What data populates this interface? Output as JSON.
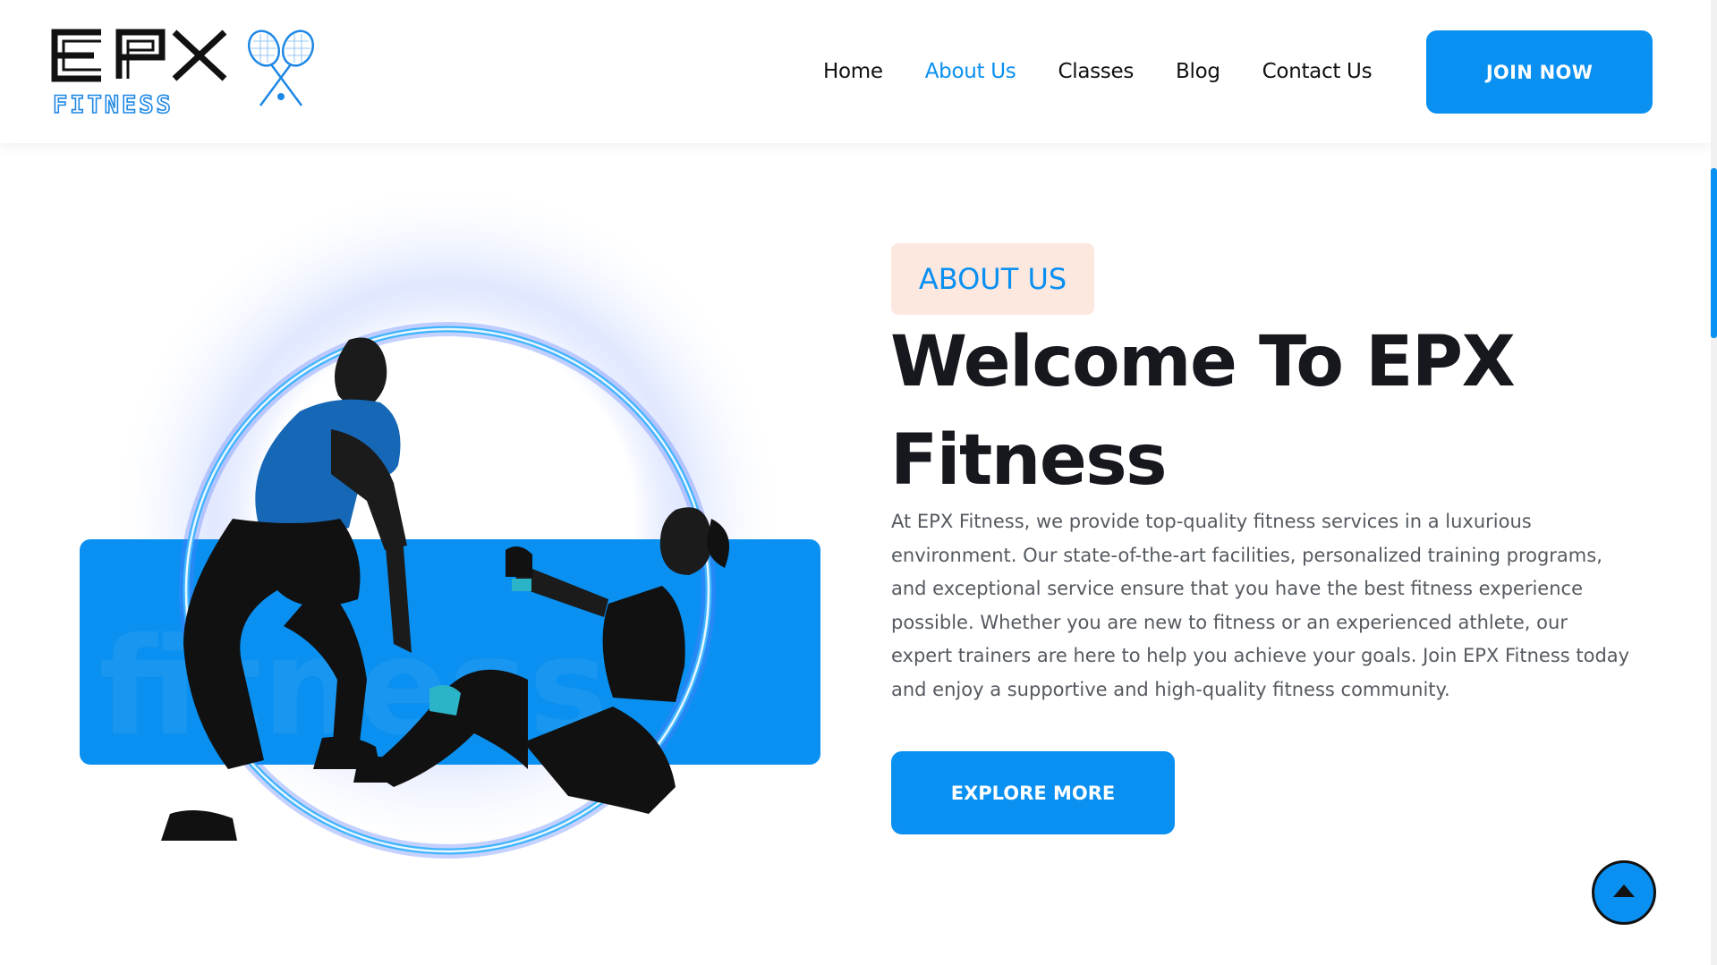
{
  "brand": {
    "logo_top": "EPX",
    "logo_bottom": "FITNESS",
    "accent_color": "#0a90f0",
    "logo_icon": "tennis-rackets-icon"
  },
  "nav": {
    "items": [
      {
        "label": "Home",
        "active": false
      },
      {
        "label": "About Us",
        "active": true
      },
      {
        "label": "Classes",
        "active": false
      },
      {
        "label": "Blog",
        "active": false
      },
      {
        "label": "Contact Us",
        "active": false
      }
    ],
    "cta_label": "JOIN NOW"
  },
  "hero": {
    "image_watermark": "fitness"
  },
  "about": {
    "badge": "ABOUT US",
    "title_line1": "Welcome To EPX",
    "title_line2": "Fitness",
    "description": "At EPX Fitness, we provide top-quality fitness services in a luxurious environment. Our state-of-the-art facilities, personalized training programs, and exceptional service ensure that you have the best fitness experience possible. Whether you are new to fitness or an experienced athlete, our expert trainers are here to help you achieve your goals. Join EPX Fitness today and enjoy a supportive and high-quality fitness community.",
    "button_label": "EXPLORE MORE"
  },
  "scroll_to_top_icon": "arrow-up-icon"
}
